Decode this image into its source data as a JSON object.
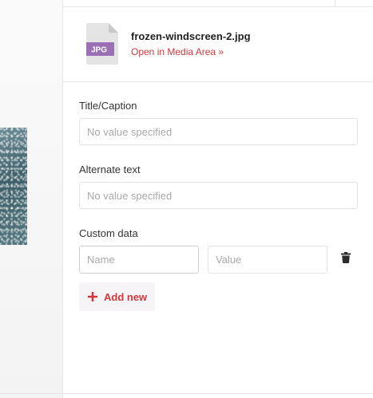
{
  "file": {
    "type_badge": "JPG",
    "name": "frozen-windscreen-2.jpg",
    "link_label": "Open in Media Area »"
  },
  "fields": {
    "title_caption": {
      "label": "Title/Caption",
      "placeholder": "No value specified",
      "value": ""
    },
    "alternate_text": {
      "label": "Alternate text",
      "placeholder": "No value specified",
      "value": ""
    },
    "custom_data": {
      "label": "Custom data",
      "name_placeholder": "Name",
      "value_placeholder": "Value",
      "add_label": "Add new"
    }
  },
  "icons": {
    "file": "file-jpg-icon",
    "delete": "trash-icon",
    "add": "plus-icon"
  },
  "colors": {
    "accent": "#d0383c",
    "badge": "#9b6fb4",
    "file_body": "#e4e4e4",
    "add_button_bg": "#f6f4f7"
  }
}
